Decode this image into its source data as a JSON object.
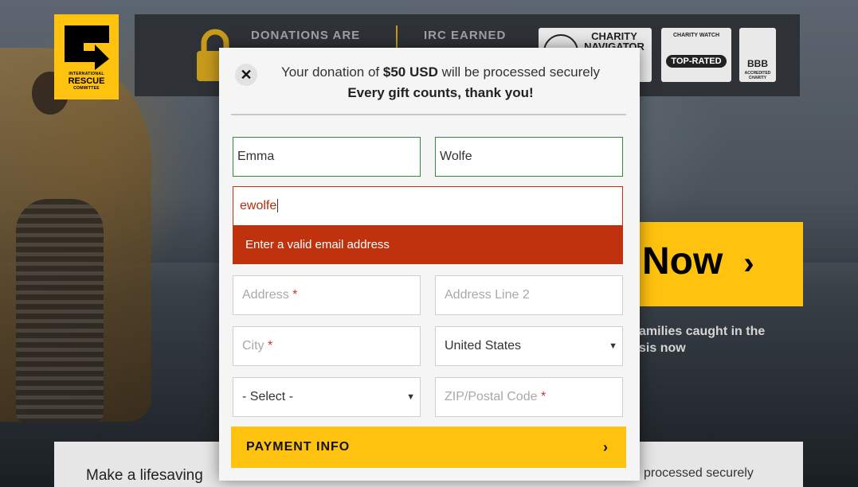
{
  "logo": {
    "line1": "INTERNATIONAL",
    "line2": "RESCUE",
    "line3": "COMMITTEE",
    "icon": "irc-logo-icon",
    "color": "#ffc20e"
  },
  "trust_bar": {
    "text_left": "DONATIONS ARE",
    "text_right": "IRC EARNED",
    "lock_icon": "lock-icon",
    "badges": {
      "charity_navigator": "CHARITY NAVIGATOR",
      "charity_watch": "TOP-RATED",
      "charity_watch_small": "CHARITY WATCH",
      "bbb": "BBB",
      "bbb_small": "ACCREDITED CHARITY"
    }
  },
  "background": {
    "donate_now": "Now",
    "tagline_line1": "amilies caught in the",
    "tagline_line2": "sis now",
    "bottom_left": "Make a lifesaving",
    "bottom_right": "processed securely"
  },
  "modal": {
    "close_icon": "close-icon",
    "line1_prefix": "Your donation of ",
    "amount": "$50 USD",
    "line1_suffix": " will be processed securely",
    "line2": "Every gift counts, thank you!",
    "fields": {
      "first_name": "Emma",
      "last_name": "Wolfe",
      "email": "ewolfe",
      "email_error": "Enter a valid email address",
      "address_placeholder": "Address",
      "address2_placeholder": "Address Line 2",
      "city_placeholder": "City",
      "country_value": "United States",
      "state_value": "- Select -",
      "zip_placeholder": "ZIP/Postal Code",
      "required_mark": "*"
    },
    "payment_button": "PAYMENT INFO",
    "payment_chevron": "›"
  },
  "colors": {
    "accent": "#ffc20e",
    "error": "#c0320d",
    "valid": "#2e8b3a"
  }
}
